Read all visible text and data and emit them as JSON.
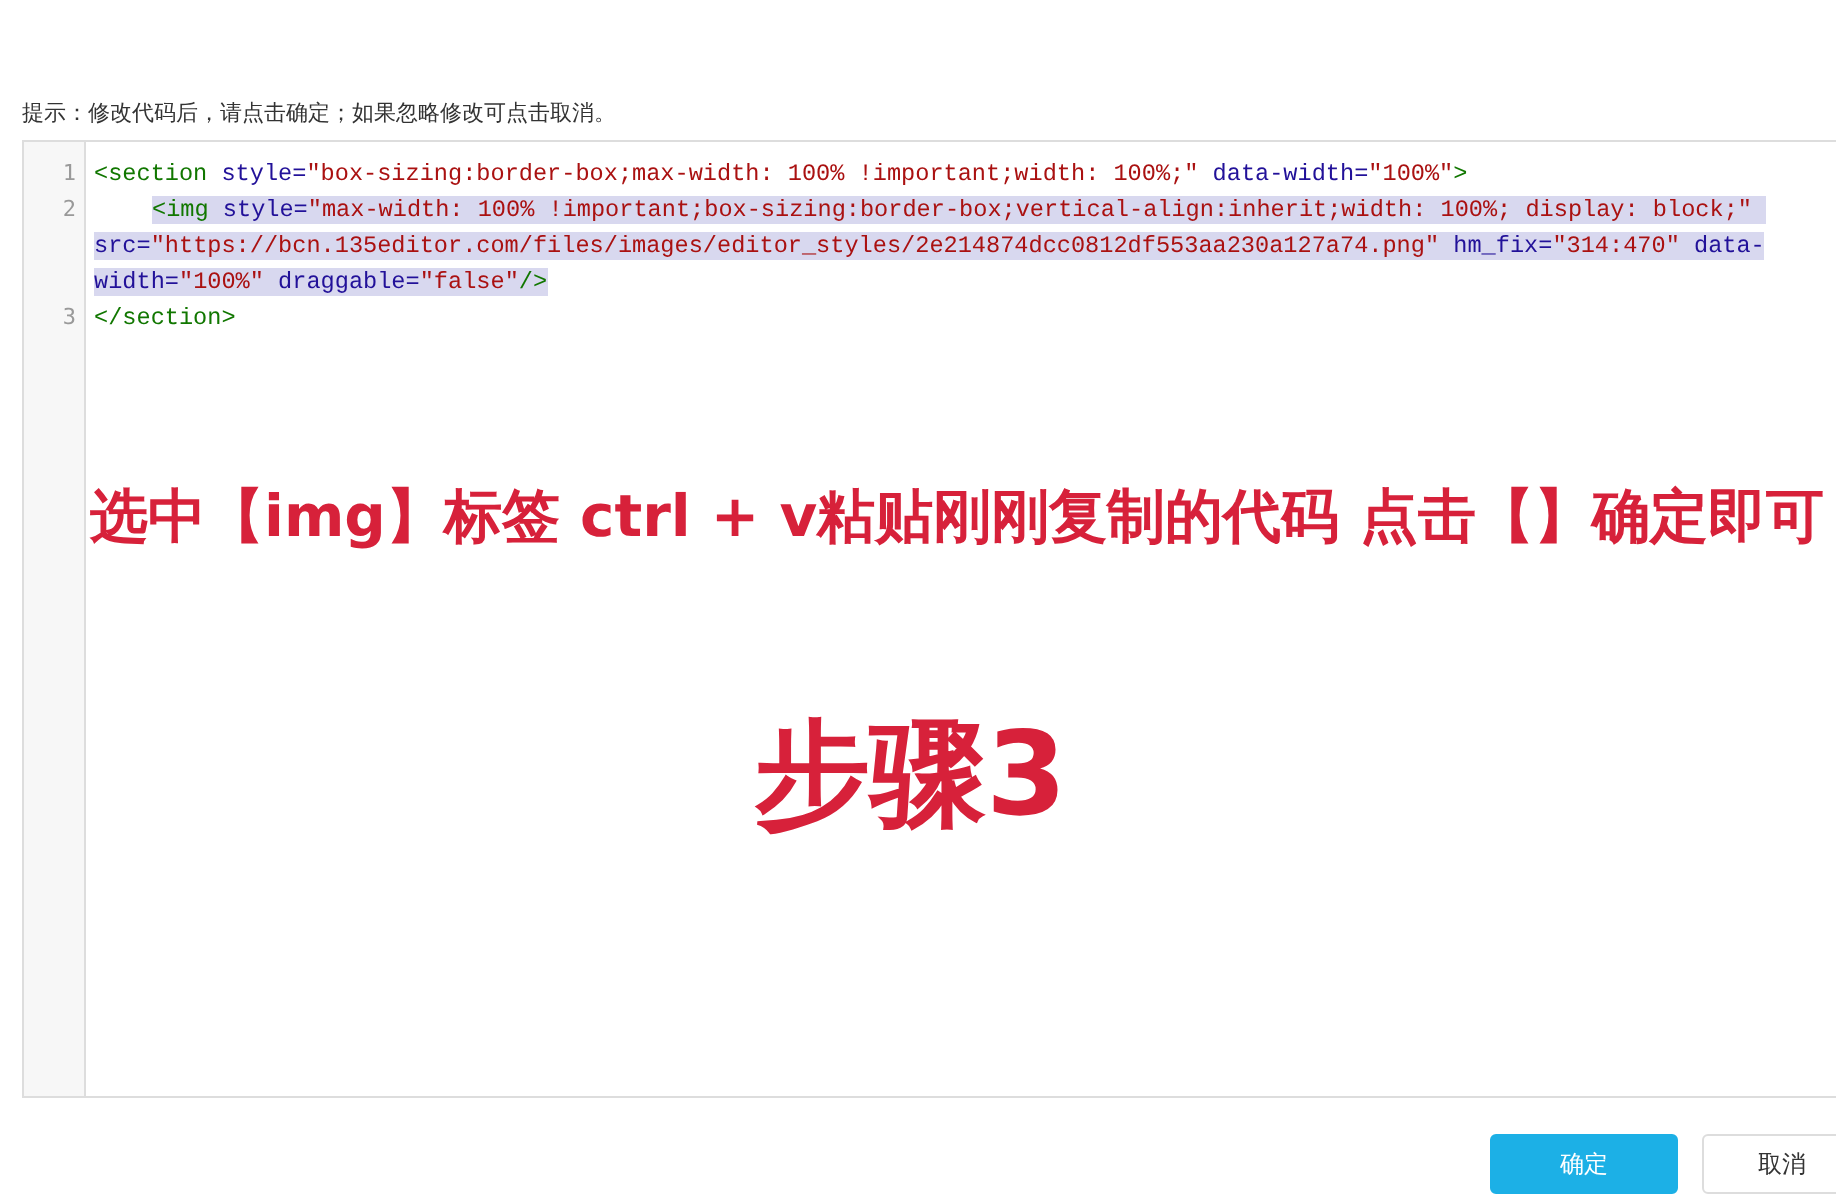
{
  "hint": "提示：修改代码后，请点击确定；如果忽略修改可点击取消。",
  "code_lines": [
    {
      "number": "1",
      "selected": false,
      "indented": false,
      "tokens": [
        {
          "kind": "tag",
          "text": "<section "
        },
        {
          "kind": "attr",
          "text": "style="
        },
        {
          "kind": "string",
          "text": "\"box-sizing:border-box;max-width: 100% !important;width: 100%;\""
        },
        {
          "kind": "attr",
          "text": " data-width="
        },
        {
          "kind": "string",
          "text": "\"100%\""
        },
        {
          "kind": "tag",
          "text": ">"
        }
      ]
    },
    {
      "number": "2",
      "selected": true,
      "indented": true,
      "tokens": [
        {
          "kind": "tag",
          "text": "<img "
        },
        {
          "kind": "attr",
          "text": "style="
        },
        {
          "kind": "string",
          "text": "\"max-width: 100% !important;box-sizing:border-box;vertical-align:inherit;width: 100%; display: block;\""
        },
        {
          "kind": "attr",
          "text": " src="
        },
        {
          "kind": "string",
          "text": "\"https://bcn.135editor.com/files/images/editor_styles/2e214874dcc0812df553aa230a127a74.png\""
        },
        {
          "kind": "attr",
          "text": " hm_fix="
        },
        {
          "kind": "string",
          "text": "\"314:470\""
        },
        {
          "kind": "attr",
          "text": " data-width="
        },
        {
          "kind": "string",
          "text": "\"100%\""
        },
        {
          "kind": "attr",
          "text": " draggable="
        },
        {
          "kind": "string",
          "text": "\"false\""
        },
        {
          "kind": "tag",
          "text": "/>"
        }
      ]
    },
    {
      "number": "3",
      "selected": false,
      "indented": false,
      "tokens": [
        {
          "kind": "tag",
          "text": "</section>"
        }
      ]
    }
  ],
  "annotation": "选中【img】标签 ctrl + v粘贴刚刚复制的代码 点击【】确定即可",
  "step_label": "步骤3",
  "buttons": [
    {
      "label": "确定",
      "kind": "primary"
    },
    {
      "label": "取消",
      "kind": "secondary"
    }
  ]
}
